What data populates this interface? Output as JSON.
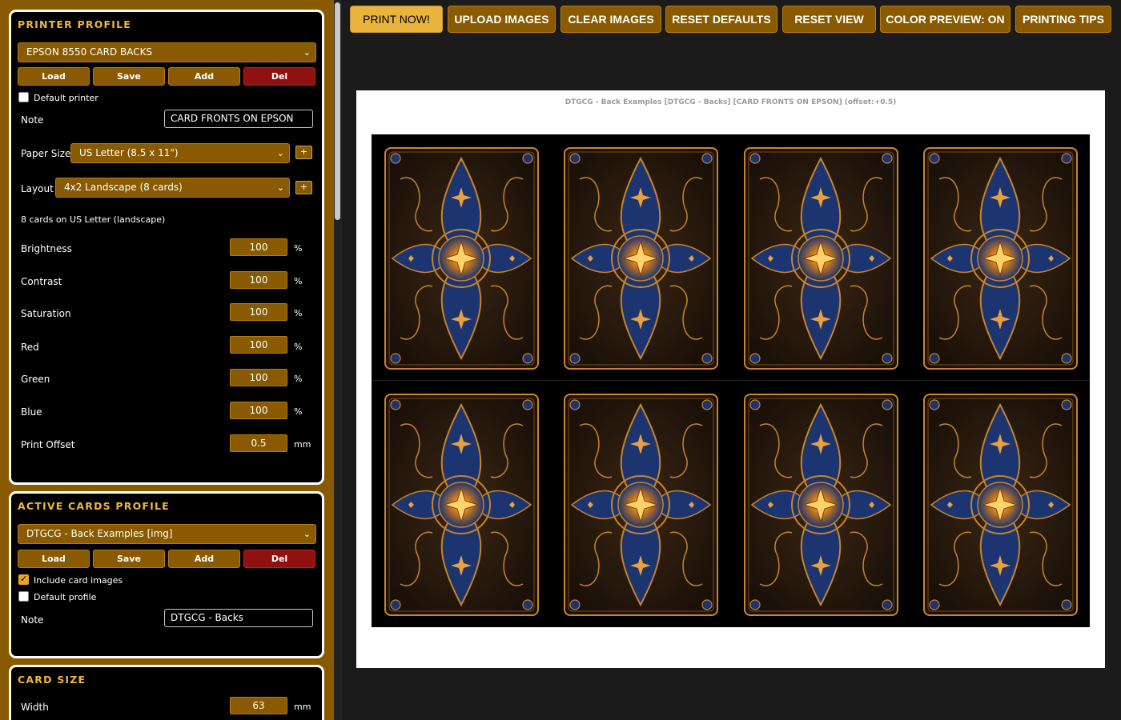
{
  "printer_profile": {
    "title": "PRINTER PROFILE",
    "selected": "EPSON 8550 CARD BACKS",
    "buttons": {
      "load": "Load",
      "save": "Save",
      "add": "Add",
      "del": "Del"
    },
    "default_printer_label": "Default printer",
    "default_printer_checked": false,
    "note_label": "Note",
    "note_value": "CARD FRONTS ON EPSON",
    "paper_size_label": "Paper Size",
    "paper_size_value": "US Letter (8.5 x 11\")",
    "layout_label": "Layout",
    "layout_value": "4x2 Landscape (8 cards)",
    "plus_label": "+",
    "layout_info": "8 cards on US Letter (landscape)",
    "adjustments": [
      {
        "label": "Brightness",
        "value": "100",
        "unit": "%"
      },
      {
        "label": "Contrast",
        "value": "100",
        "unit": "%"
      },
      {
        "label": "Saturation",
        "value": "100",
        "unit": "%"
      },
      {
        "label": "Red",
        "value": "100",
        "unit": "%"
      },
      {
        "label": "Green",
        "value": "100",
        "unit": "%"
      },
      {
        "label": "Blue",
        "value": "100",
        "unit": "%"
      },
      {
        "label": "Print Offset",
        "value": "0.5",
        "unit": "mm"
      }
    ]
  },
  "cards_profile": {
    "title": "ACTIVE CARDS PROFILE",
    "selected": "DTGCG - Back Examples [img]",
    "buttons": {
      "load": "Load",
      "save": "Save",
      "add": "Add",
      "del": "Del"
    },
    "include_images_label": "Include card images",
    "include_images_checked": true,
    "default_profile_label": "Default profile",
    "default_profile_checked": false,
    "note_label": "Note",
    "note_value": "DTGCG - Backs"
  },
  "card_size": {
    "title": "CARD SIZE",
    "width_label": "Width",
    "width_value": "63",
    "width_unit": "mm"
  },
  "toolbar": {
    "print_now": "PRINT NOW!",
    "upload_images": "UPLOAD IMAGES",
    "clear_images": "CLEAR IMAGES",
    "reset_defaults": "RESET DEFAULTS",
    "reset_view": "RESET VIEW",
    "color_preview": "COLOR PREVIEW: ON",
    "printing_tips": "PRINTING TIPS"
  },
  "preview": {
    "caption": "DTGCG - Back Examples [DTGCG - Backs] [CARD FRONTS ON EPSON] (offset:+0.5)",
    "card_count": 8
  },
  "colors": {
    "accent": "#8a5a00",
    "title_gold": "#f0b63a",
    "primary_button": "#e9b43e",
    "delete_button": "#8f1210",
    "card_blue": "#1c3470",
    "card_gold": "#c8852a"
  },
  "icons": {
    "select_chevron": "chevron-down-icon",
    "checkbox_checked": "check-icon"
  }
}
